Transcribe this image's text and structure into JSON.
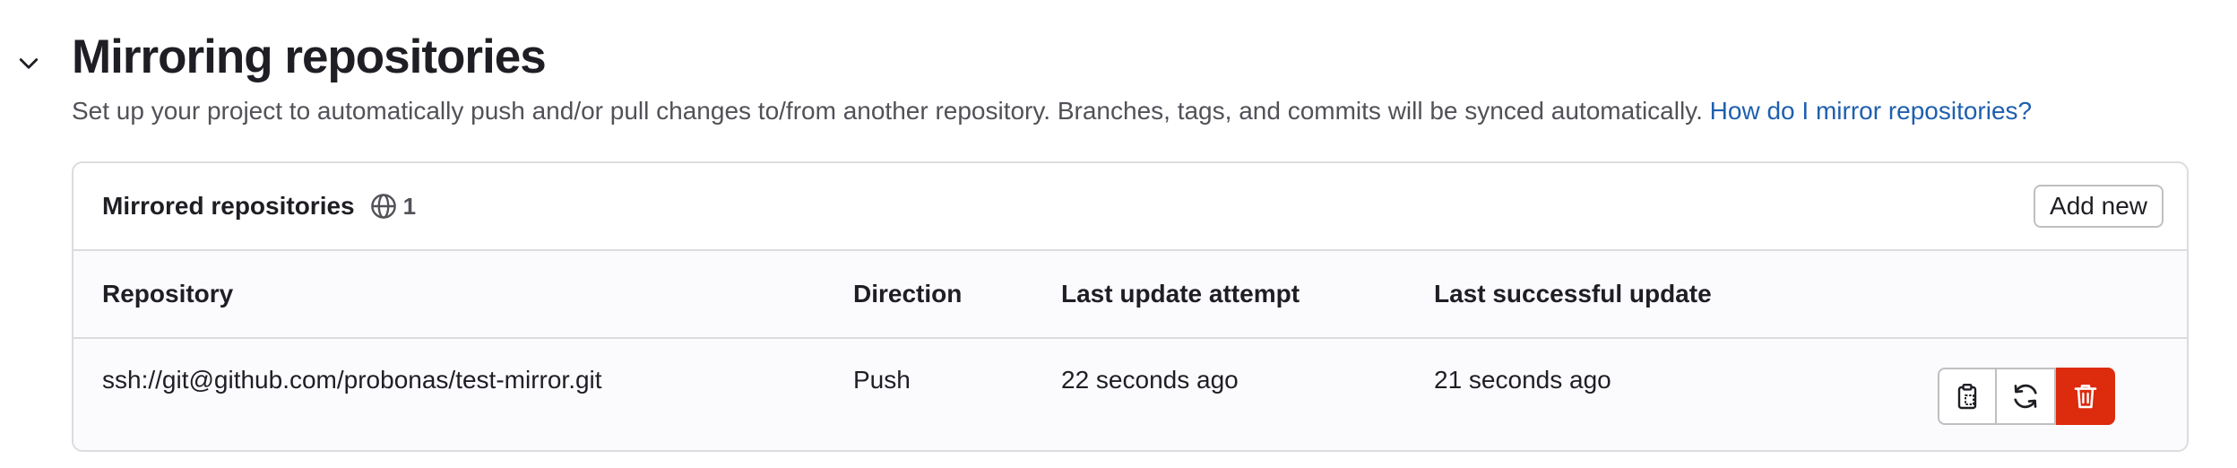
{
  "section": {
    "title": "Mirroring repositories",
    "description": "Set up your project to automatically push and/or pull changes to/from another repository. Branches, tags, and commits will be synced automatically.",
    "help_link": "How do I mirror repositories?"
  },
  "card": {
    "title": "Mirrored repositories",
    "count": "1",
    "add_new_label": "Add new"
  },
  "table": {
    "columns": [
      "Repository",
      "Direction",
      "Last update attempt",
      "Last successful update"
    ],
    "rows": [
      {
        "repository": "ssh://git@github.com/probonas/test-mirror.git",
        "direction": "Push",
        "last_attempt": "22 seconds ago",
        "last_success": "21 seconds ago"
      }
    ]
  },
  "icons": {
    "toggle": "chevron-down-icon",
    "count": "globe-icon",
    "copy": "copy-to-clipboard-icon",
    "update": "retry-icon",
    "remove": "remove-icon"
  },
  "colors": {
    "link": "#1f5fae",
    "danger": "#dd2b0e",
    "border": "#dcdcde",
    "text": "#1f1e24",
    "muted": "#535158"
  }
}
